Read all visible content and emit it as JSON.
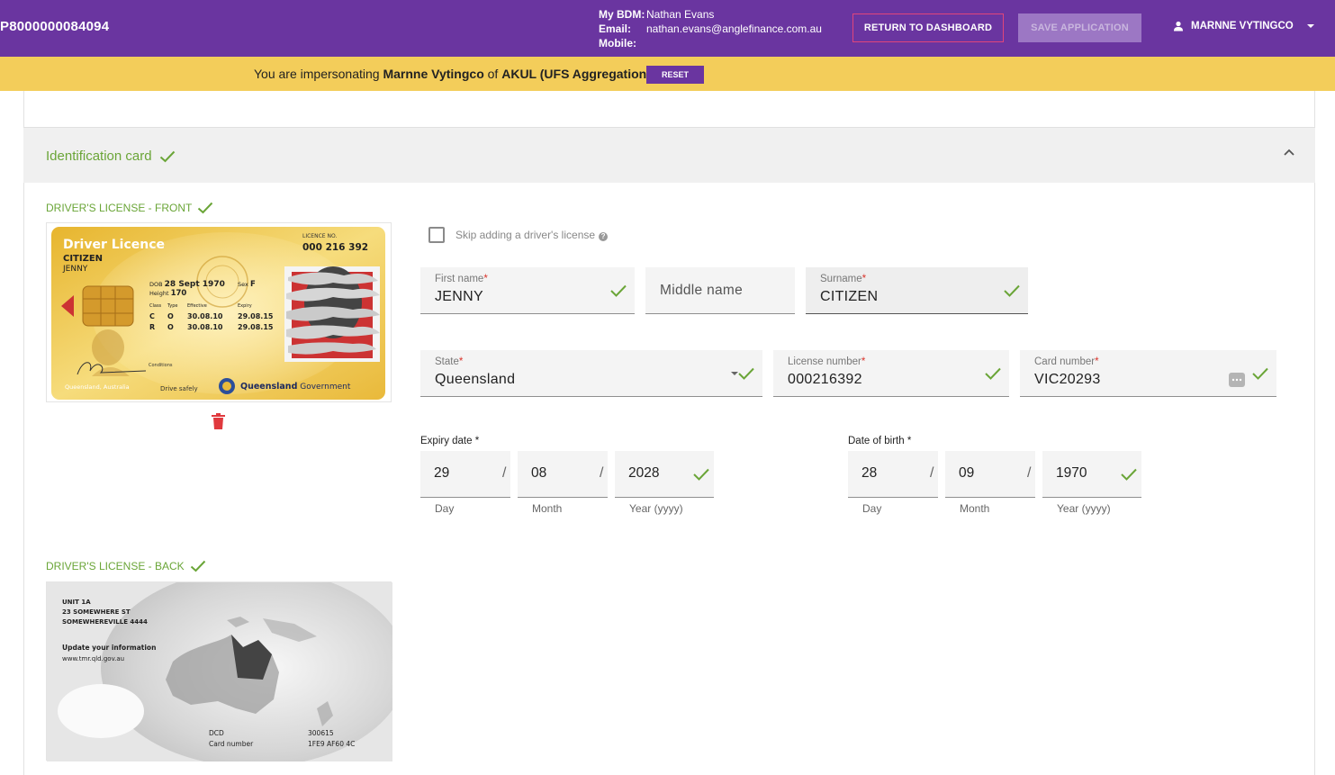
{
  "header": {
    "application_id": "P8000000084094",
    "bdm_label": "My BDM:",
    "bdm_name": "Nathan Evans",
    "email_label": "Email:",
    "email": "nathan.evans@anglefinance.com.au",
    "mobile_label": "Mobile:",
    "mobile": "",
    "return_label": "RETURN TO DASHBOARD",
    "save_label": "SAVE APPLICATION",
    "user_name": "MARNNE VYTINGCO"
  },
  "impersonation": {
    "prefix": "You are impersonating ",
    "user": "Marnne Vytingco",
    "middle": " of ",
    "org": "AKUL (UFS Aggregation)",
    "suffix": ".",
    "reset_label": "RESET"
  },
  "section": {
    "title": "Identification card"
  },
  "front": {
    "label": "DRIVER'S LICENSE - FRONT",
    "card": {
      "title": "Driver Licence",
      "licence_no_label": "LICENCE NO.",
      "licence_no": "000 216 392",
      "surname": "CITIZEN",
      "given": "JENNY",
      "dob_label": "DOB",
      "dob": "28 Sept 1970",
      "sex_label": "Sex",
      "sex": "F",
      "height_label": "Height",
      "height": "170",
      "class_label": "Class",
      "type_label": "Type",
      "effective_label": "Effective",
      "expiry_label": "Expiry",
      "row1_class": "C",
      "row1_type": "O",
      "row1_eff": "30.08.10",
      "row1_exp": "29.08.15",
      "row2_class": "R",
      "row2_type": "O",
      "row2_eff": "30.08.10",
      "row2_exp": "29.08.15",
      "conditions_label": "Conditions",
      "footer_left": "Queensland, Australia",
      "footer_mid": "Drive safely",
      "gov_bold": "Queensland",
      "gov_rest": " Government"
    }
  },
  "back": {
    "label": "DRIVER'S LICENSE - BACK",
    "card": {
      "addr1": "UNIT 1A",
      "addr2": "23 SOMEWHERE ST",
      "addr3": "SOMEWHEREVILLE 4444",
      "update1": "Update your information",
      "update2": "www.tmr.qld.gov.au",
      "dcd": "DCD",
      "dcd_val": "300615",
      "cardnum_label": "Card number",
      "cardnum_val": "1FE9 AF60 4C"
    }
  },
  "skip_label": "Skip adding a driver's license",
  "fields": {
    "first_name_label": "First name",
    "first_name": "JENNY",
    "middle_name_placeholder": "Middle name",
    "surname_label": "Surname",
    "surname": "CITIZEN",
    "state_label": "State",
    "state": "Queensland",
    "license_number_label": "License number",
    "license_number": "000216392",
    "card_number_label": "Card number",
    "card_number": "VIC20293",
    "required_mark": "*"
  },
  "expiry": {
    "label": "Expiry date *",
    "day": "29",
    "month": "08",
    "year": "2028",
    "day_label": "Day",
    "month_label": "Month",
    "year_label": "Year (yyyy)"
  },
  "dob": {
    "label": "Date of birth *",
    "day": "28",
    "month": "09",
    "year": "1970",
    "day_label": "Day",
    "month_label": "Month",
    "year_label": "Year (yyyy)"
  },
  "colors": {
    "brand_purple": "#6a35a0",
    "banner_yellow": "#f3cd5a",
    "success_green": "#6aa537",
    "accent_pink": "#e0457b",
    "delete_red": "#e0393e"
  }
}
